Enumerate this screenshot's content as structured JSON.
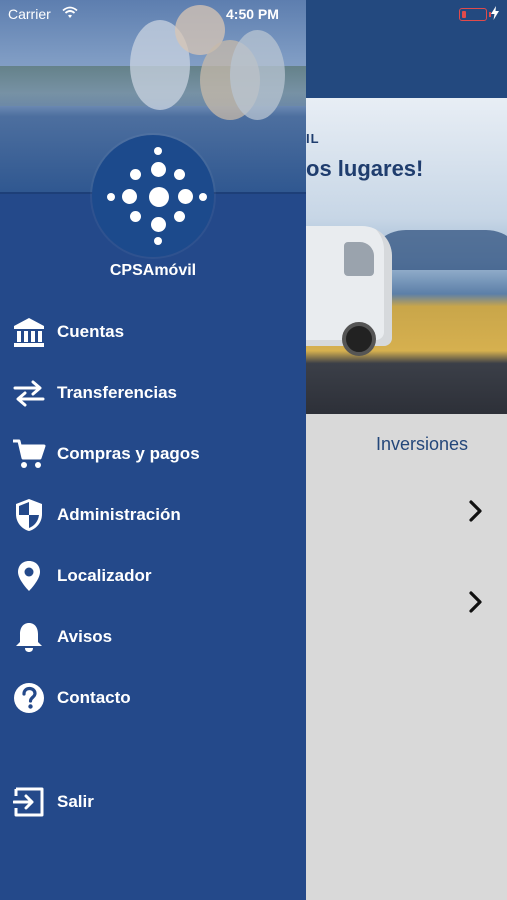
{
  "status_bar": {
    "carrier": "Carrier",
    "time": "4:50 PM"
  },
  "drawer": {
    "brand": "CPSAmóvil",
    "menu": [
      {
        "label": "Cuentas",
        "icon": "bank-icon"
      },
      {
        "label": "Transferencias",
        "icon": "swap-arrows-icon"
      },
      {
        "label": "Compras y pagos",
        "icon": "shopping-cart-icon"
      },
      {
        "label": "Administración",
        "icon": "shield-icon"
      },
      {
        "label": "Localizador",
        "icon": "location-pin-icon"
      },
      {
        "label": "Avisos",
        "icon": "bell-icon"
      },
      {
        "label": "Contacto",
        "icon": "help-circle-icon"
      }
    ],
    "logout": {
      "label": "Salir",
      "icon": "logout-icon"
    }
  },
  "background": {
    "banner_kicker": "IL",
    "banner_title": "os lugares!",
    "section_label": "Inversiones"
  },
  "colors": {
    "drawer": "#24498a",
    "header": "#23497f",
    "content": "#d9d9d9",
    "accent_text": "#24477a"
  }
}
